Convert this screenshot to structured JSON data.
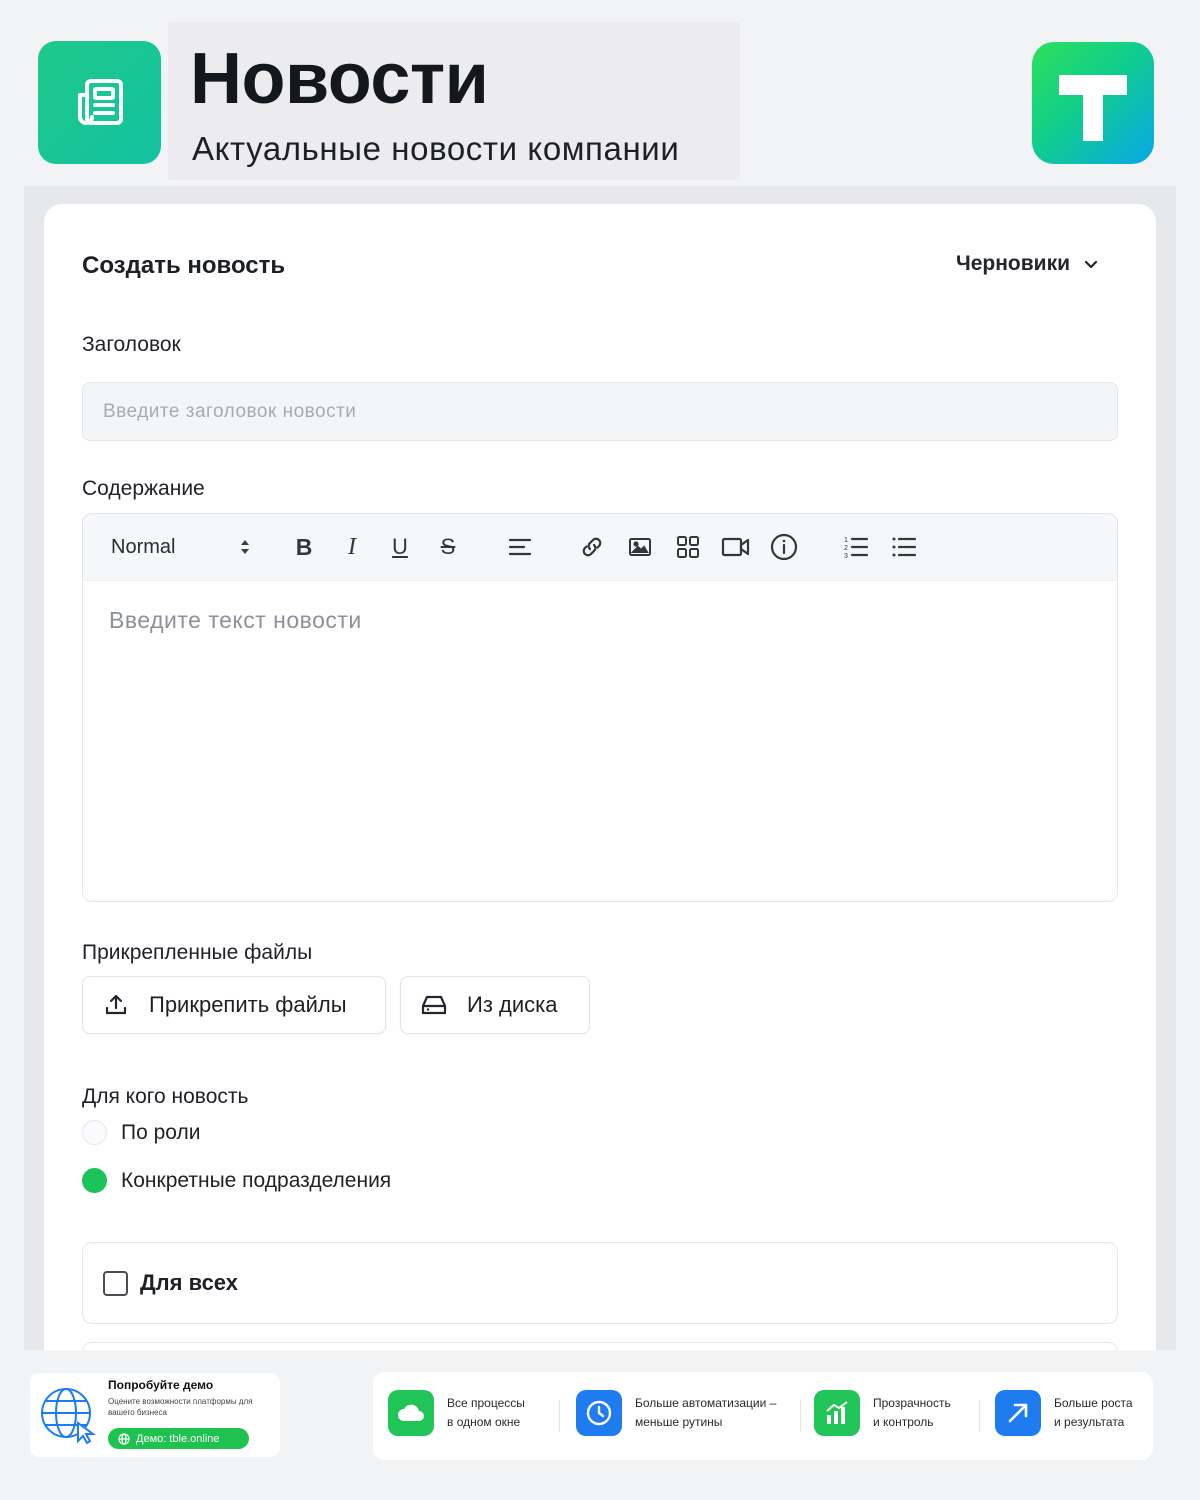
{
  "header": {
    "title": "Новости",
    "subtitle": "Актуальные новости компании",
    "app_icon": "newspaper-icon",
    "brand_logo_letter": "T"
  },
  "card": {
    "title": "Создать новость",
    "drafts_label": "Черновики",
    "title_field": {
      "label": "Заголовок",
      "placeholder": "Введите заголовок новости",
      "value": ""
    },
    "content": {
      "label": "Содержание",
      "format_select": "Normal",
      "toolbar_icons": [
        "bold-icon",
        "italic-icon",
        "underline-icon",
        "strikethrough-icon",
        "align-icon",
        "link-icon",
        "image-icon",
        "grid-icon",
        "video-icon",
        "info-icon",
        "ordered-list-icon",
        "bullet-list-icon"
      ],
      "toolbar_glyphs": {
        "bold": "B",
        "italic": "I",
        "underline": "U",
        "strike": "S"
      },
      "placeholder": "Введите текст новости"
    },
    "attachments": {
      "label": "Прикрепленные файлы",
      "attach_button": "Прикрепить файлы",
      "disk_button": "Из диска"
    },
    "audience": {
      "label": "Для кого новость",
      "options": [
        {
          "label": "По роли",
          "selected": false
        },
        {
          "label": "Конкретные подразделения",
          "selected": true
        }
      ],
      "for_all_label": "Для всех",
      "for_all_checked": false
    }
  },
  "footer": {
    "demo": {
      "title": "Попробуйте демо",
      "description": "Оцените возможности платформы для вашего бизнеса",
      "link": "Демо: tble.online"
    },
    "features": [
      {
        "line1": "Все процессы",
        "line2": "в одном окне",
        "icon": "cloud-icon",
        "color": "#21c456"
      },
      {
        "line1": "Больше автоматизации –",
        "line2": "меньше рутины",
        "icon": "clock-icon",
        "color": "#1f7cf0"
      },
      {
        "line1": "Прозрачность",
        "line2": "и контроль",
        "icon": "growth-chart-icon",
        "color": "#21c456"
      },
      {
        "line1": "Больше роста",
        "line2": "и результата",
        "icon": "arrow-up-right-icon",
        "color": "#1f7cf0"
      }
    ]
  }
}
